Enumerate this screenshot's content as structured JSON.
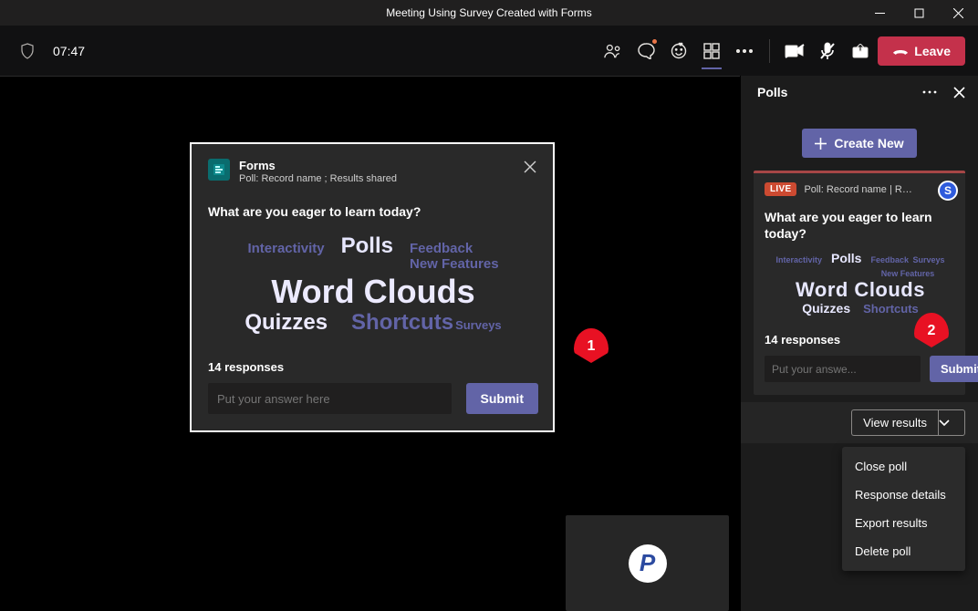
{
  "window": {
    "title": "Meeting Using Survey Created with Forms"
  },
  "toolbar": {
    "time": "07:47",
    "leave_label": "Leave"
  },
  "side_panel": {
    "title": "Polls",
    "create_label": "Create New",
    "poll": {
      "live_label": "LIVE",
      "subtitle": "Poll: Record name | Results s...",
      "avatar_initial": "S",
      "question": "What are you eager to learn today?",
      "words": {
        "interactivity": "Interactivity",
        "polls": "Polls",
        "feedback": "Feedback",
        "surveys": "Surveys",
        "new_features": "New Features",
        "word_clouds": "Word Clouds",
        "quizzes": "Quizzes",
        "shortcuts": "Shortcuts"
      },
      "responses": "14 responses",
      "answer_placeholder": "Put your answe...",
      "submit_label": "Submit"
    },
    "view_results_label": "View results",
    "menu": {
      "close_poll": "Close poll",
      "response_details": "Response details",
      "export_results": "Export results",
      "delete_poll": "Delete poll"
    }
  },
  "big_card": {
    "app": "Forms",
    "subtitle": "Poll: Record name ; Results shared",
    "question": "What are you eager to learn today?",
    "words": {
      "interactivity": "Interactivity",
      "polls": "Polls",
      "feedback": "Feedback",
      "new_features": "New Features",
      "word_clouds": "Word Clouds",
      "quizzes": "Quizzes",
      "shortcuts": "Shortcuts",
      "surveys": "Surveys"
    },
    "responses": "14 responses",
    "answer_placeholder": "Put your answer here",
    "submit_label": "Submit"
  },
  "annotations": {
    "pin1": "1",
    "pin2": "2"
  },
  "stage": {
    "avatar_initial": "P"
  }
}
